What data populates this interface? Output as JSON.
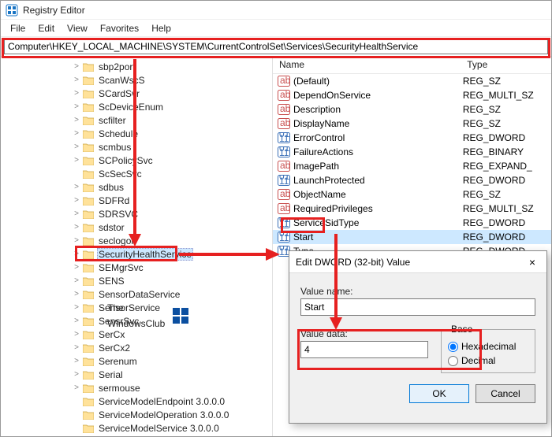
{
  "app": {
    "title": "Registry Editor"
  },
  "menu": {
    "items": [
      "File",
      "Edit",
      "View",
      "Favorites",
      "Help"
    ]
  },
  "address": {
    "value": "Computer\\HKEY_LOCAL_MACHINE\\SYSTEM\\CurrentControlSet\\Services\\SecurityHealthService"
  },
  "tree": {
    "items": [
      {
        "label": "sbp2port",
        "exp": ">"
      },
      {
        "label": "ScanWscS",
        "exp": ">"
      },
      {
        "label": "SCardSvr",
        "exp": ">"
      },
      {
        "label": "ScDeviceEnum",
        "exp": ">"
      },
      {
        "label": "scfilter",
        "exp": ">"
      },
      {
        "label": "Schedule",
        "exp": ">"
      },
      {
        "label": "scmbus",
        "exp": ">"
      },
      {
        "label": "SCPolicySvc",
        "exp": ">"
      },
      {
        "label": "ScSecSvc",
        "exp": ""
      },
      {
        "label": "sdbus",
        "exp": ">"
      },
      {
        "label": "SDFRd",
        "exp": ">"
      },
      {
        "label": "SDRSVC",
        "exp": ">"
      },
      {
        "label": "sdstor",
        "exp": ">"
      },
      {
        "label": "seclogon",
        "exp": ">"
      },
      {
        "label": "SecurityHealthService",
        "exp": ">",
        "selected": true
      },
      {
        "label": "SEMgrSvc",
        "exp": ">"
      },
      {
        "label": "SENS",
        "exp": ">"
      },
      {
        "label": "SensorDataService",
        "exp": ">"
      },
      {
        "label": "SensorService",
        "exp": ">"
      },
      {
        "label": "SensrSvc",
        "exp": ">"
      },
      {
        "label": "SerCx",
        "exp": ">"
      },
      {
        "label": "SerCx2",
        "exp": ">"
      },
      {
        "label": "Serenum",
        "exp": ">"
      },
      {
        "label": "Serial",
        "exp": ">"
      },
      {
        "label": "sermouse",
        "exp": ">"
      },
      {
        "label": "ServiceModelEndpoint 3.0.0.0",
        "exp": ""
      },
      {
        "label": "ServiceModelOperation 3.0.0.0",
        "exp": ""
      },
      {
        "label": "ServiceModelService 3.0.0.0",
        "exp": ""
      }
    ]
  },
  "list": {
    "headers": {
      "name": "Name",
      "type": "Type"
    },
    "rows": [
      {
        "name": "(Default)",
        "type": "REG_SZ",
        "kind": "str"
      },
      {
        "name": "DependOnService",
        "type": "REG_MULTI_SZ",
        "kind": "str"
      },
      {
        "name": "Description",
        "type": "REG_SZ",
        "kind": "str"
      },
      {
        "name": "DisplayName",
        "type": "REG_SZ",
        "kind": "str"
      },
      {
        "name": "ErrorControl",
        "type": "REG_DWORD",
        "kind": "bin"
      },
      {
        "name": "FailureActions",
        "type": "REG_BINARY",
        "kind": "bin"
      },
      {
        "name": "ImagePath",
        "type": "REG_EXPAND_",
        "kind": "str"
      },
      {
        "name": "LaunchProtected",
        "type": "REG_DWORD",
        "kind": "bin"
      },
      {
        "name": "ObjectName",
        "type": "REG_SZ",
        "kind": "str"
      },
      {
        "name": "RequiredPrivileges",
        "type": "REG_MULTI_SZ",
        "kind": "str"
      },
      {
        "name": "ServiceSidType",
        "type": "REG_DWORD",
        "kind": "bin"
      },
      {
        "name": "Start",
        "type": "REG_DWORD",
        "kind": "bin",
        "selected": true
      },
      {
        "name": "Type",
        "type": "REG_DWORD",
        "kind": "bin"
      }
    ]
  },
  "dialog": {
    "title": "Edit DWORD (32-bit) Value",
    "value_name_label": "Value name:",
    "value_name": "Start",
    "value_data_label": "Value data:",
    "value_data": "4",
    "base_label": "Base",
    "hex_label": "Hexadecimal",
    "dec_label": "Decimal",
    "ok": "OK",
    "cancel": "Cancel",
    "close": "×"
  },
  "watermark": {
    "line1": "The",
    "line2": "WindowsClub"
  }
}
